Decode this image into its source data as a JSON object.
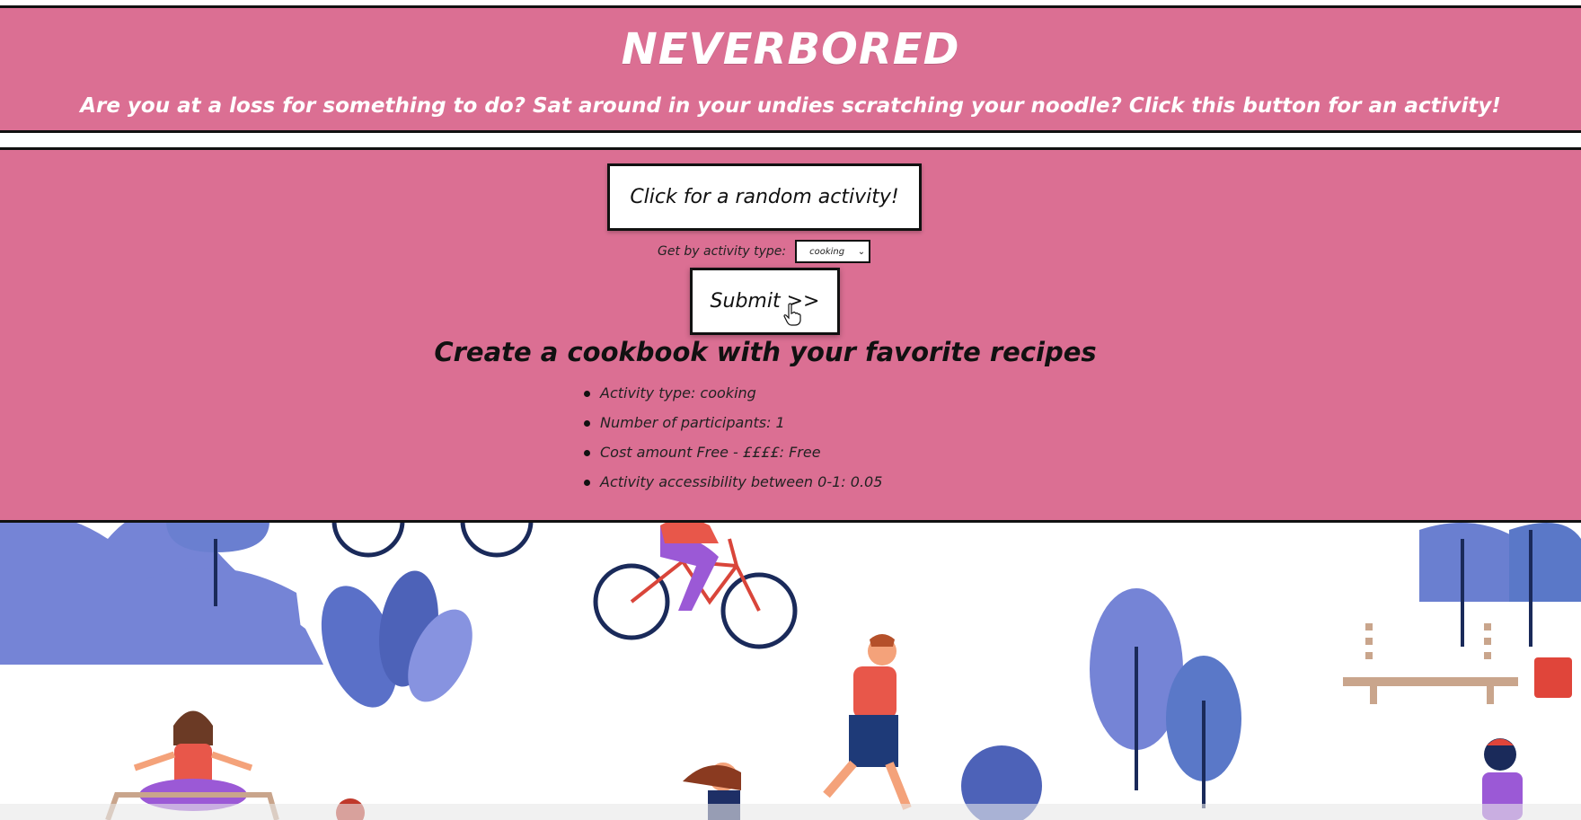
{
  "header": {
    "title": "NEVERBORED",
    "tagline": "Are you at a loss for something to do? Sat around in your undies scratching your noodle? Click this button for an activity!"
  },
  "controls": {
    "random_button": "Click for a random activity!",
    "type_label": "Get by activity type:",
    "type_selected": "cooking",
    "submit_label": "Submit >>"
  },
  "activity": {
    "title": "Create a cookbook with your favorite recipes",
    "details": [
      "Activity type: cooking",
      "Number of participants: 1",
      "Cost amount Free - ££££: Free",
      "Activity accessibility between 0-1: 0.05"
    ]
  },
  "colors": {
    "panel": "#db6f93",
    "border": "#111111",
    "button_bg": "#ffffff",
    "illustration_blue": "#6f7fd6",
    "illustration_navy": "#1a2a5a",
    "illustration_red": "#e8574a",
    "illustration_purple": "#9b59d6"
  },
  "icons": {
    "cursor": "hand-pointer-icon",
    "dropdown": "chevron-down-icon"
  }
}
